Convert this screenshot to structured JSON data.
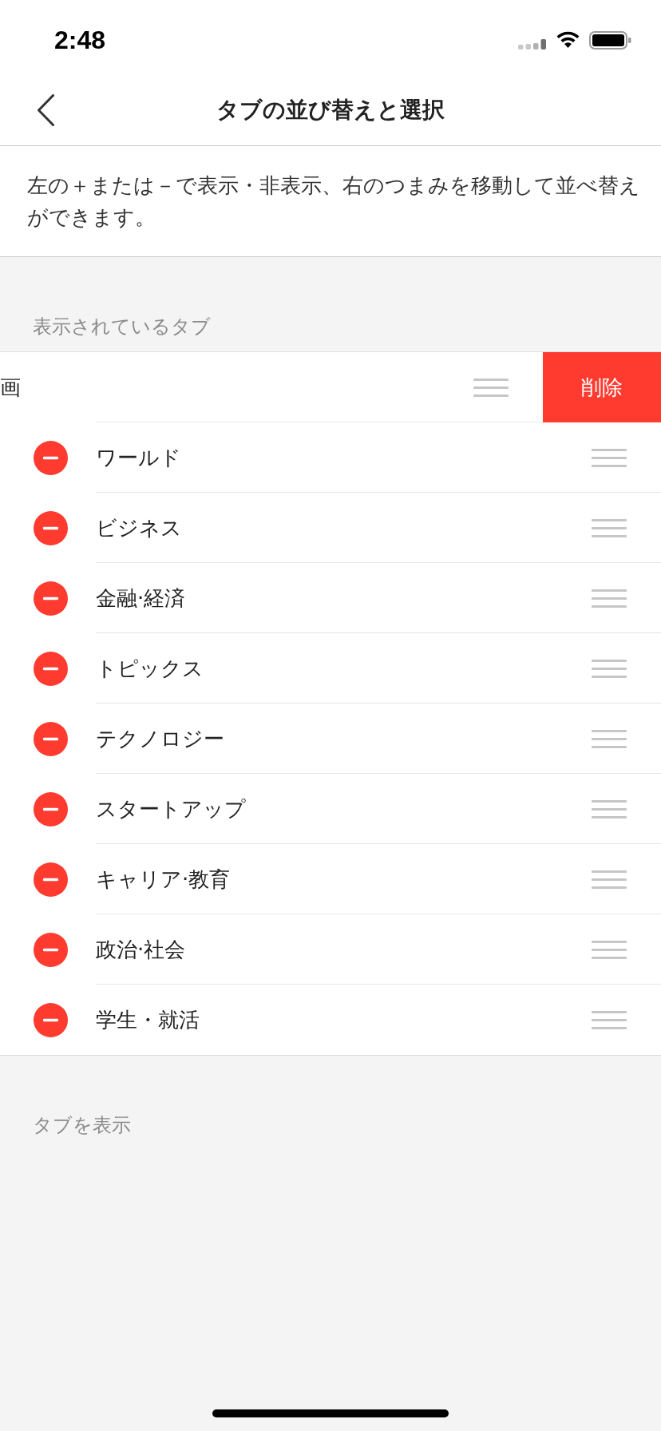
{
  "status_bar": {
    "time": "2:48"
  },
  "nav_bar": {
    "title": "タブの並び替えと選択"
  },
  "description": "左の＋または－で表示・非表示、右のつまみを移動して並べ替えができます。",
  "shown_tabs": {
    "header": "表示されているタブ",
    "rows": [
      {
        "label": "画",
        "swiped": true,
        "action": "削除"
      },
      {
        "label": "ワールド",
        "swiped": false
      },
      {
        "label": "ビジネス",
        "swiped": false
      },
      {
        "label": "金融·経済",
        "swiped": false
      },
      {
        "label": "トピックス",
        "swiped": false
      },
      {
        "label": "テクノロジー",
        "swiped": false
      },
      {
        "label": "スタートアップ",
        "swiped": false
      },
      {
        "label": "キャリア·教育",
        "swiped": false
      },
      {
        "label": "政治·社会",
        "swiped": false
      },
      {
        "label": "学生・就活",
        "swiped": false
      }
    ]
  },
  "hidden_tabs": {
    "header": "タブを表示"
  }
}
